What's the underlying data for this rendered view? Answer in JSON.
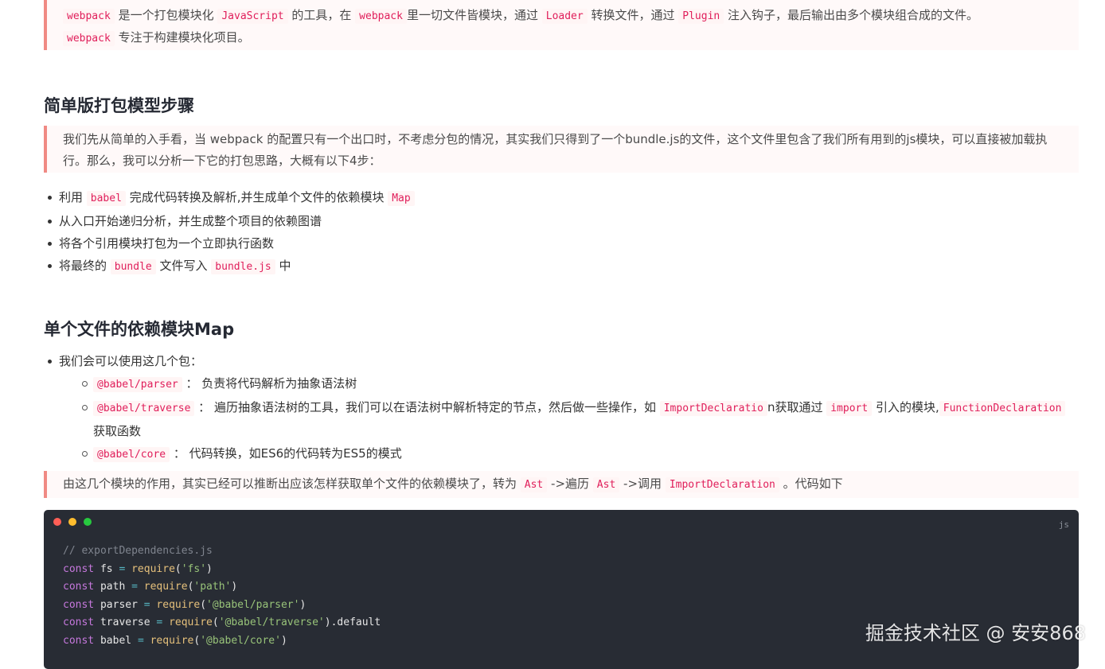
{
  "quote1": {
    "line1": [
      {
        "t": "code",
        "v": "webpack"
      },
      {
        "t": "text",
        "v": " 是一个打包模块化 "
      },
      {
        "t": "code",
        "v": "JavaScript"
      },
      {
        "t": "text",
        "v": " 的工具，在 "
      },
      {
        "t": "code",
        "v": "webpack"
      },
      {
        "t": "text",
        "v": "里一切文件皆模块，通过 "
      },
      {
        "t": "code",
        "v": "Loader"
      },
      {
        "t": "text",
        "v": " 转换文件，通过 "
      },
      {
        "t": "code",
        "v": "Plugin"
      },
      {
        "t": "text",
        "v": " 注入钩子，最后输出由多个模块组合成的文件。"
      }
    ],
    "line2": [
      {
        "t": "code",
        "v": "webpack"
      },
      {
        "t": "text",
        "v": " 专注于构建模块化项目。"
      }
    ]
  },
  "section1": {
    "heading": "简单版打包模型步骤",
    "quote": "我们先从简单的入手看，当 webpack 的配置只有一个出口时，不考虑分包的情况，其实我们只得到了一个bundle.js的文件，这个文件里包含了我们所有用到的js模块，可以直接被加载执行。那么，我可以分析一下它的打包思路，大概有以下4步：",
    "items": [
      [
        {
          "t": "text",
          "v": "利用 "
        },
        {
          "t": "code",
          "v": "babel"
        },
        {
          "t": "text",
          "v": " 完成代码转换及解析,并生成单个文件的依赖模块 "
        },
        {
          "t": "code",
          "v": "Map"
        }
      ],
      [
        {
          "t": "text",
          "v": "从入口开始递归分析，并生成整个项目的依赖图谱"
        }
      ],
      [
        {
          "t": "text",
          "v": "将各个引用模块打包为一个立即执行函数"
        }
      ],
      [
        {
          "t": "text",
          "v": "将最终的 "
        },
        {
          "t": "code",
          "v": "bundle"
        },
        {
          "t": "text",
          "v": " 文件写入 "
        },
        {
          "t": "code",
          "v": "bundle.js"
        },
        {
          "t": "text",
          "v": " 中"
        }
      ]
    ]
  },
  "section2": {
    "heading": "单个文件的依赖模块Map",
    "item": "我们会可以使用这几个包：",
    "subitems": [
      [
        {
          "t": "code",
          "v": "@babel/parser"
        },
        {
          "t": "text",
          "v": " ： 负责将代码解析为抽象语法树"
        }
      ],
      [
        {
          "t": "code",
          "v": "@babel/traverse"
        },
        {
          "t": "text",
          "v": " ： 遍历抽象语法树的工具，我们可以在语法树中解析特定的节点，然后做一些操作，如 "
        },
        {
          "t": "code",
          "v": "ImportDeclaratio"
        },
        {
          "t": "text",
          "v": "n获取通过 "
        },
        {
          "t": "code",
          "v": "import"
        },
        {
          "t": "text",
          "v": " 引入的模块,"
        },
        {
          "t": "code",
          "v": "FunctionDeclaration"
        },
        {
          "t": "text",
          "v": " 获取函数"
        }
      ],
      [
        {
          "t": "code",
          "v": "@babel/core"
        },
        {
          "t": "text",
          "v": " ： 代码转换，如ES6的代码转为ES5的模式"
        }
      ]
    ],
    "quote": [
      {
        "t": "text",
        "v": "由这几个模块的作用，其实已经可以推断出应该怎样获取单个文件的依赖模块了，转为 "
      },
      {
        "t": "code",
        "v": "Ast"
      },
      {
        "t": "text",
        "v": " ->遍历 "
      },
      {
        "t": "code",
        "v": "Ast"
      },
      {
        "t": "text",
        "v": " ->调用 "
      },
      {
        "t": "code",
        "v": "ImportDeclaration"
      },
      {
        "t": "text",
        "v": " 。代码如下"
      }
    ]
  },
  "code": {
    "lang": "js",
    "lines": [
      [
        {
          "c": "cm",
          "v": "// exportDependencies.js"
        }
      ],
      [
        {
          "c": "kw",
          "v": "const"
        },
        {
          "c": "var",
          "v": " fs "
        },
        {
          "c": "op",
          "v": "="
        },
        {
          "c": "var",
          "v": " "
        },
        {
          "c": "fn",
          "v": "require"
        },
        {
          "c": "var",
          "v": "("
        },
        {
          "c": "str",
          "v": "'fs'"
        },
        {
          "c": "var",
          "v": ")"
        }
      ],
      [
        {
          "c": "kw",
          "v": "const"
        },
        {
          "c": "var",
          "v": " path "
        },
        {
          "c": "op",
          "v": "="
        },
        {
          "c": "var",
          "v": " "
        },
        {
          "c": "fn",
          "v": "require"
        },
        {
          "c": "var",
          "v": "("
        },
        {
          "c": "str",
          "v": "'path'"
        },
        {
          "c": "var",
          "v": ")"
        }
      ],
      [
        {
          "c": "kw",
          "v": "const"
        },
        {
          "c": "var",
          "v": " parser "
        },
        {
          "c": "op",
          "v": "="
        },
        {
          "c": "var",
          "v": " "
        },
        {
          "c": "fn",
          "v": "require"
        },
        {
          "c": "var",
          "v": "("
        },
        {
          "c": "str",
          "v": "'@babel/parser'"
        },
        {
          "c": "var",
          "v": ")"
        }
      ],
      [
        {
          "c": "kw",
          "v": "const"
        },
        {
          "c": "var",
          "v": " traverse "
        },
        {
          "c": "op",
          "v": "="
        },
        {
          "c": "var",
          "v": " "
        },
        {
          "c": "fn",
          "v": "require"
        },
        {
          "c": "var",
          "v": "("
        },
        {
          "c": "str",
          "v": "'@babel/traverse'"
        },
        {
          "c": "var",
          "v": ").default"
        }
      ],
      [
        {
          "c": "kw",
          "v": "const"
        },
        {
          "c": "var",
          "v": " babel "
        },
        {
          "c": "op",
          "v": "="
        },
        {
          "c": "var",
          "v": " "
        },
        {
          "c": "fn",
          "v": "require"
        },
        {
          "c": "var",
          "v": "("
        },
        {
          "c": "str",
          "v": "'@babel/core'"
        },
        {
          "c": "var",
          "v": ")"
        }
      ]
    ]
  },
  "watermark": "掘金技术社区 @ 安安868",
  "colors": {
    "accent_border": "#f08a84",
    "code_bg": "#282c34",
    "inline_code": "#e01e5a"
  }
}
